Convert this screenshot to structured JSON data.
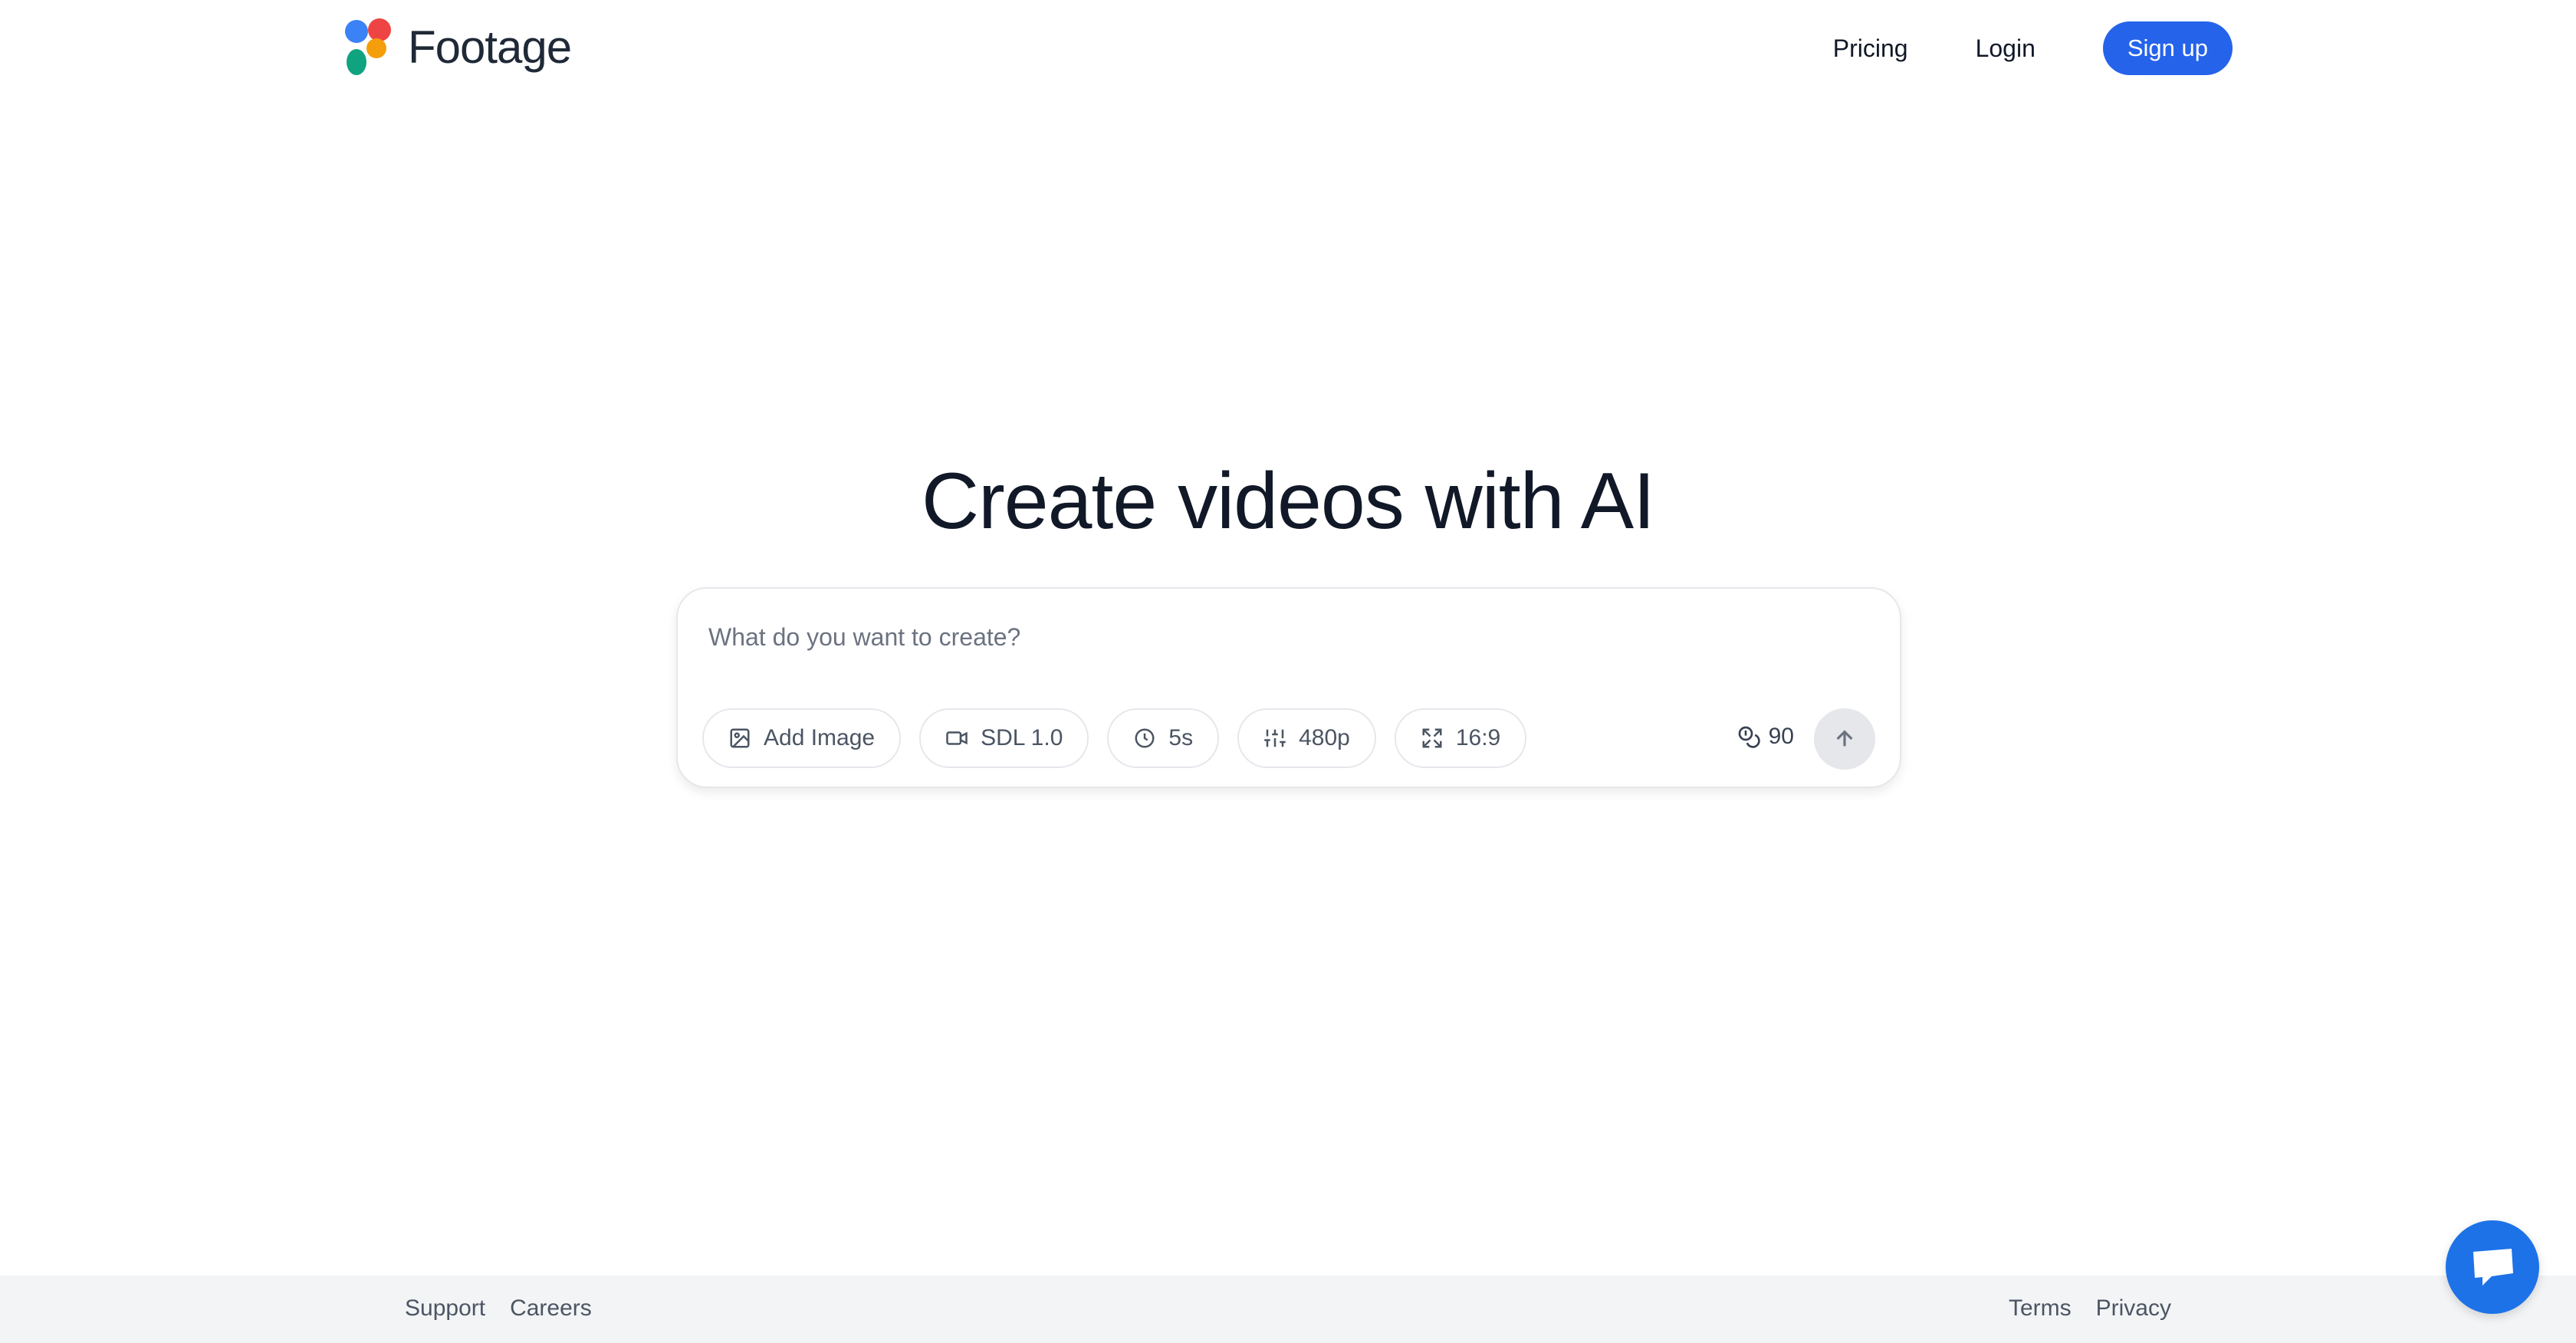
{
  "brand": {
    "name": "Footage"
  },
  "nav": {
    "pricing": "Pricing",
    "login": "Login",
    "signup": "Sign up"
  },
  "hero": {
    "title": "Create videos with AI"
  },
  "prompt": {
    "placeholder": "What do you want to create?",
    "value": "",
    "options": {
      "add_image": "Add Image",
      "model": "SDL 1.0",
      "duration": "5s",
      "resolution": "480p",
      "aspect_ratio": "16:9"
    },
    "credits": "90"
  },
  "footer": {
    "support": "Support",
    "careers": "Careers",
    "terms": "Terms",
    "privacy": "Privacy"
  },
  "colors": {
    "accent": "#2563eb",
    "chat": "#1d72e8"
  },
  "icons": [
    "image-icon",
    "video-camera-icon",
    "clock-icon",
    "sliders-icon",
    "expand-icon",
    "coins-icon",
    "arrow-up-icon",
    "chat-icon"
  ]
}
